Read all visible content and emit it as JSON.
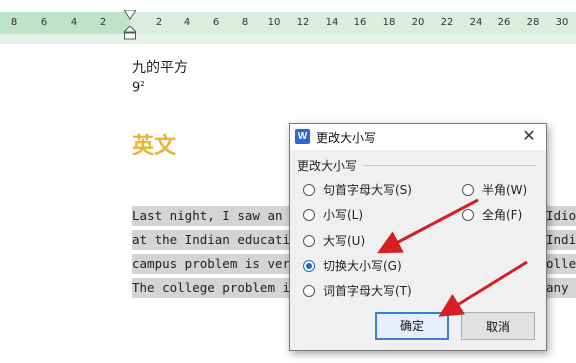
{
  "ruler": {
    "left_ticks": [
      "8",
      "6",
      "4",
      "2"
    ],
    "right_ticks": [
      "2",
      "4",
      "6",
      "8",
      "10",
      "12",
      "14",
      "16",
      "18",
      "20",
      "22",
      "24",
      "26",
      "28",
      "30"
    ]
  },
  "document": {
    "line1": "九的平方",
    "line2_base": "9",
    "line2_sup": "2",
    "heading": "英文",
    "paragraph": [
      "Last night, I saw an I",
      "at the Indian educati",
      "campus problem is ver",
      "The college problem i"
    ],
    "paragraph_tail": [
      "Idiot",
      "India",
      "olleg",
      "any m"
    ]
  },
  "dialog": {
    "title": "更改大小写",
    "group_label": "更改大小写",
    "options_left": [
      {
        "label": "句首字母大写(S)",
        "checked": false
      },
      {
        "label": "小写(L)",
        "checked": false
      },
      {
        "label": "大写(U)",
        "checked": false
      },
      {
        "label": "切换大小写(G)",
        "checked": true
      },
      {
        "label": "词首字母大写(T)",
        "checked": false
      }
    ],
    "options_right": [
      {
        "label": "半角(W)",
        "checked": false
      },
      {
        "label": "全角(F)",
        "checked": false
      }
    ],
    "ok_label": "确定",
    "cancel_label": "取消",
    "close_symbol": "✕",
    "icon_letter": "W"
  },
  "colors": {
    "heading": "#e8b534",
    "arrow": "#d42020",
    "accent": "#1e66d0"
  }
}
